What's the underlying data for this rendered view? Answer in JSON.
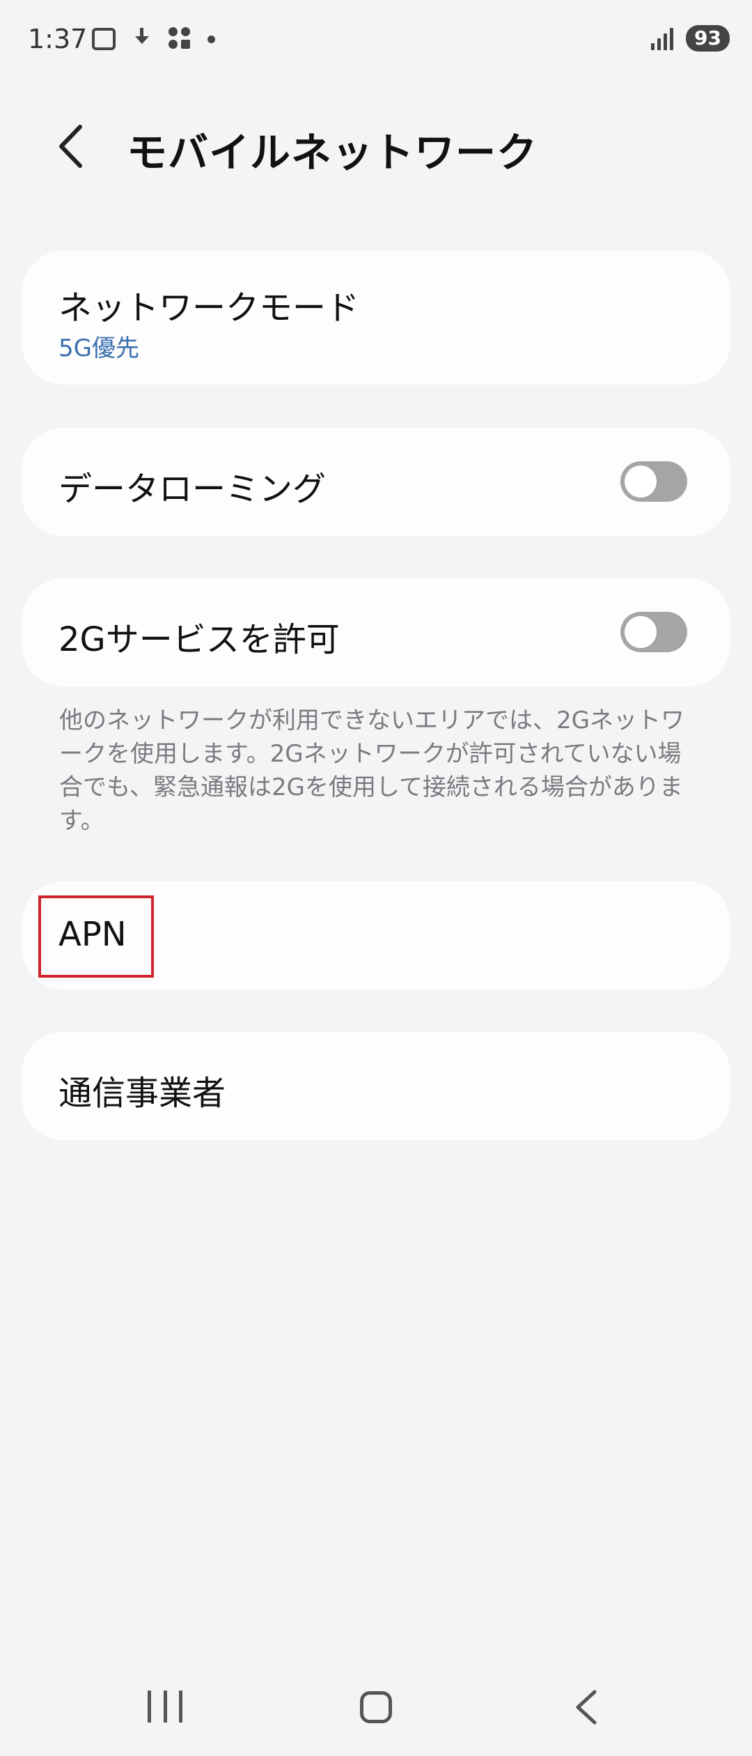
{
  "status_bar": {
    "time": "1:37",
    "battery": "93",
    "icons": [
      "screenshot-icon",
      "download-icon",
      "apps-icon",
      "notification-dot-icon",
      "signal-icon"
    ]
  },
  "header": {
    "title": "モバイルネットワーク",
    "back_icon": "chevron-left-icon"
  },
  "settings": {
    "network_mode": {
      "label": "ネットワークモード",
      "value": "5G優先"
    },
    "data_roaming": {
      "label": "データローミング",
      "enabled": false
    },
    "allow_2g": {
      "label": "2Gサービスを許可",
      "enabled": false
    },
    "allow_2g_description": "他のネットワークが利用できないエリアでは、2Gネットワークを使用します。2Gネットワークが許可されていない場合でも、緊急通報は2Gを使用して接続される場合があります。",
    "apn": {
      "label": "APN"
    },
    "carrier": {
      "label": "通信事業者"
    }
  },
  "nav_bar": {
    "icons": [
      "recents-icon",
      "home-icon",
      "back-icon"
    ]
  },
  "colors": {
    "background": "#f4f4f6",
    "card": "#fdfdfd",
    "accent_link": "#3a6fb0",
    "highlight": "#d0242d",
    "toggle_off": "#a5a5a8"
  }
}
